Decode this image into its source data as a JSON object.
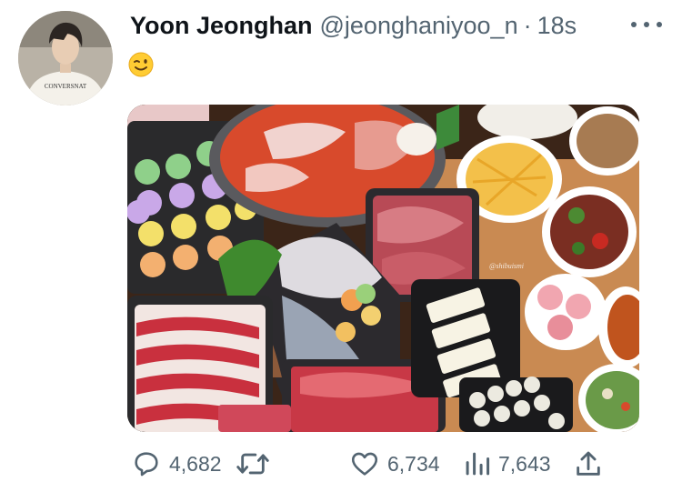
{
  "tweet": {
    "display_name": "Yoon Jeonghan",
    "handle": "@jeonghaniyoo_n",
    "separator": "·",
    "time": "18s",
    "text_emoji": "winking-face",
    "avatar": {
      "shirt_text": "CONVERSNAT"
    },
    "media": {
      "watermark": "@shibuismi"
    }
  },
  "actions": {
    "replies": "4,682",
    "retweets": "",
    "likes": "6,734",
    "views": "7,643"
  },
  "colors": {
    "text_primary": "#0f1419",
    "text_secondary": "#536471",
    "background": "#ffffff"
  }
}
